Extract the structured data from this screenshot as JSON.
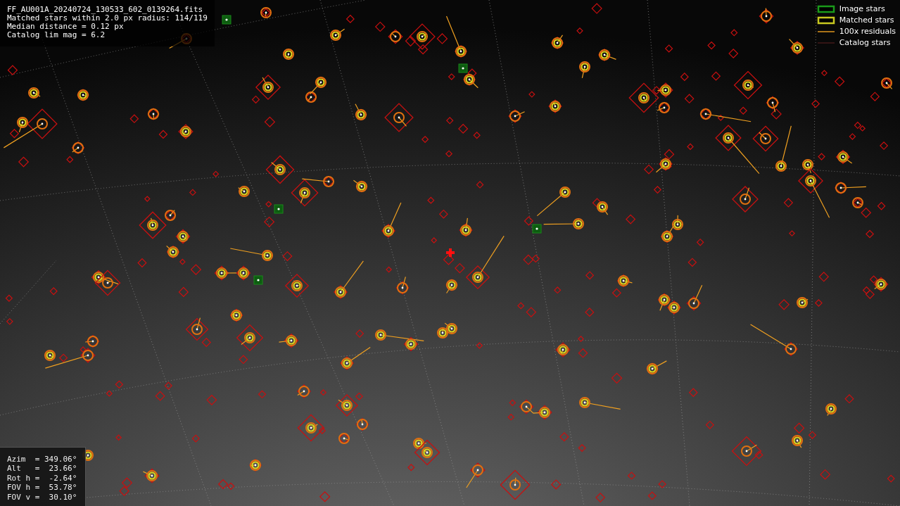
{
  "header": {
    "lines": [
      "FF_AU001A_20240724_130533_602_0139264.fits",
      "Matched stars within 2.0 px radius: 114/119",
      "Median distance = 0.12 px",
      "Catalog lim mag = 6.2"
    ]
  },
  "legend": [
    {
      "kind": "image",
      "label": "Image stars"
    },
    {
      "kind": "matched",
      "label": "Matched stars"
    },
    {
      "kind": "residual",
      "label": "100x residuals"
    },
    {
      "kind": "catalog",
      "label": "Catalog stars"
    }
  ],
  "pointing": {
    "lines": [
      "Azim  = 349.06°",
      "Alt   =  23.66°",
      "Rot h =  -2.64°",
      "FOV h =  53.78°",
      "FOV v =  30.10°"
    ]
  }
}
